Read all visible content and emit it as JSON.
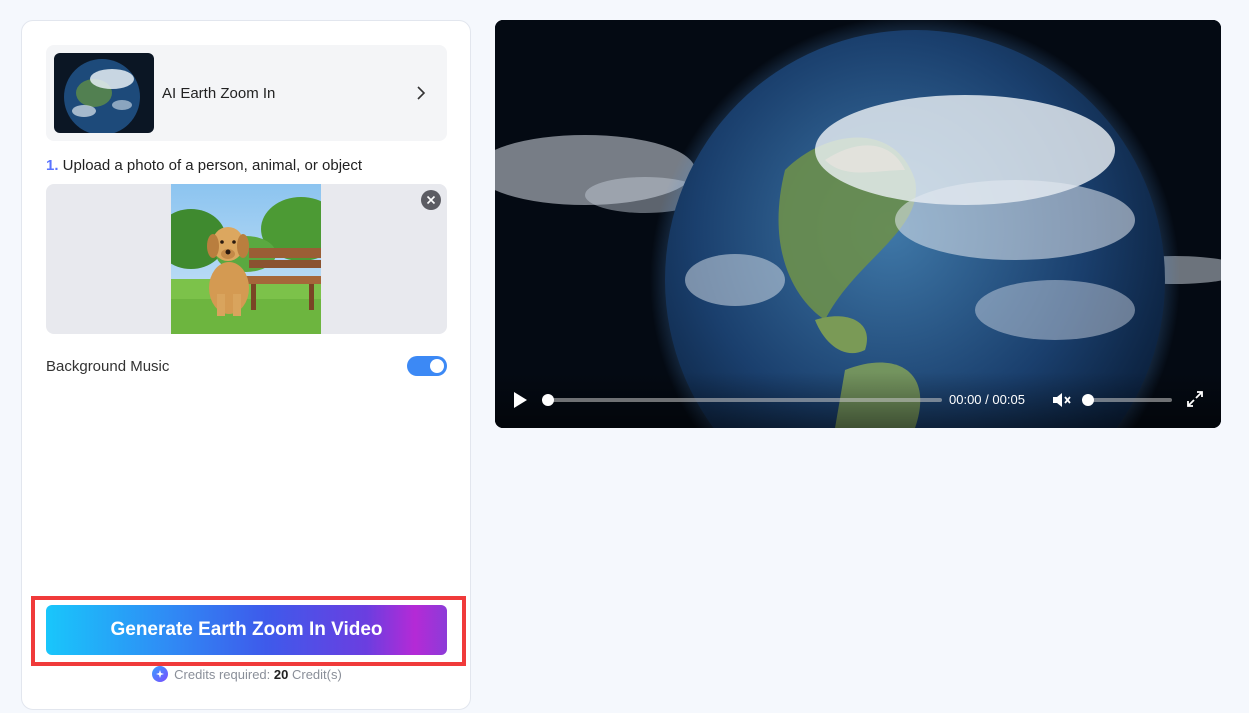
{
  "effect": {
    "title": "AI Earth Zoom In",
    "thumbnail_icon": "earth-thumbnail",
    "chevron_icon": "chevron-right-icon"
  },
  "upload": {
    "step_number": "1.",
    "step_text": " Upload a photo of a person, animal, or object",
    "photo_icon": "dog-on-grass-photo",
    "remove_icon": "close-circle-icon"
  },
  "music": {
    "label": "Background Music",
    "enabled": true
  },
  "generate": {
    "label": "Generate Earth Zoom In Video"
  },
  "credits": {
    "prefix": "Credits required: ",
    "amount": "20",
    "suffix": " Credit(s)"
  },
  "player": {
    "current_time": "00:00",
    "separator": " / ",
    "duration": "00:05",
    "progress": 0,
    "volume": 0,
    "muted": true
  },
  "colors": {
    "accent": "#3c89f5",
    "step_number": "#5a73ff",
    "highlight": "#f03a3a"
  }
}
